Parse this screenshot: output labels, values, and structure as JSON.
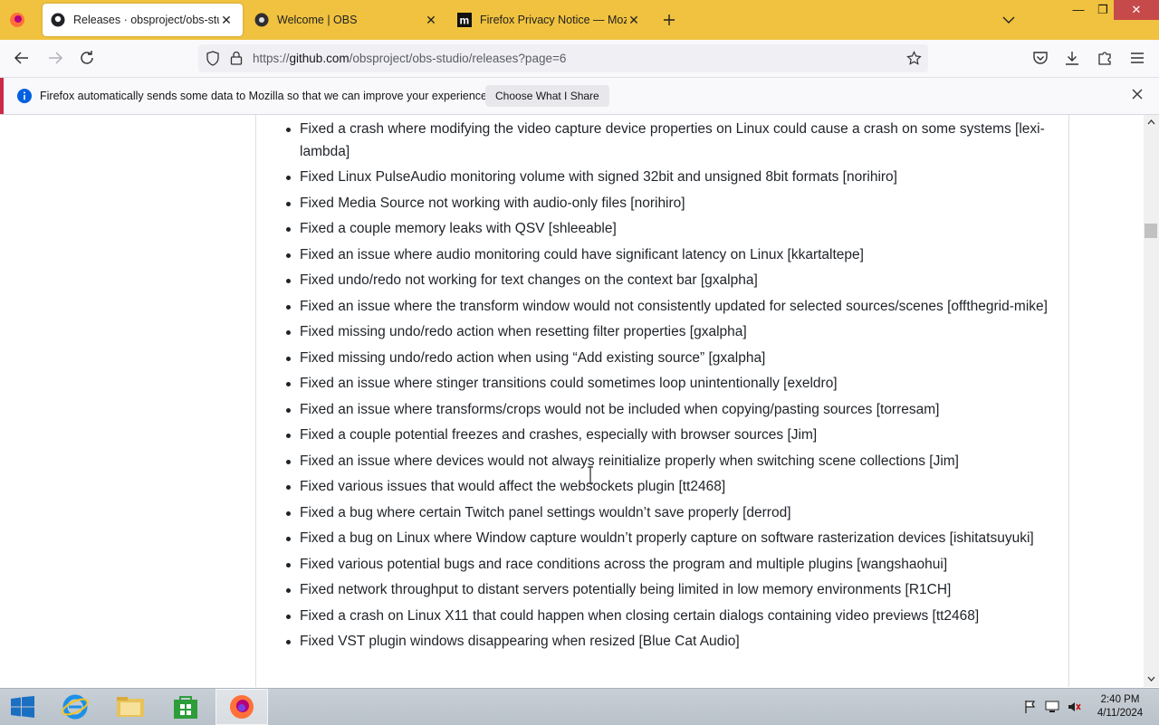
{
  "tabs": [
    {
      "title": "Releases · obsproject/obs-studi",
      "icon": "github-icon",
      "active": true
    },
    {
      "title": "Welcome | OBS",
      "icon": "obs-icon",
      "active": false
    },
    {
      "title": "Firefox Privacy Notice — Mozill",
      "icon": "mozilla-icon",
      "active": false
    }
  ],
  "address": {
    "prefix": "https://",
    "host": "github.com",
    "path": "/obsproject/obs-studio/releases?page=6"
  },
  "notification": {
    "message": "Firefox automatically sends some data to Mozilla so that we can improve your experience.",
    "button": "Choose What I Share"
  },
  "release_notes": [
    "Fixed a crash where modifying the video capture device properties on Linux could cause a crash on some systems [lexi-lambda]",
    "Fixed Linux PulseAudio monitoring volume with signed 32bit and unsigned 8bit formats [norihiro]",
    "Fixed Media Source not working with audio-only files [norihiro]",
    "Fixed a couple memory leaks with QSV [shleeable]",
    "Fixed an issue where audio monitoring could have significant latency on Linux [kkartaltepe]",
    "Fixed undo/redo not working for text changes on the context bar [gxalpha]",
    "Fixed an issue where the transform window would not consistently updated for selected sources/scenes [offthegrid-mike]",
    "Fixed missing undo/redo action when resetting filter properties [gxalpha]",
    "Fixed missing undo/redo action when using “Add existing source” [gxalpha]",
    "Fixed an issue where stinger transitions could sometimes loop unintentionally [exeldro]",
    "Fixed an issue where transforms/crops would not be included when copying/pasting sources [torresam]",
    "Fixed a couple potential freezes and crashes, especially with browser sources [Jim]",
    "Fixed an issue where devices would not always reinitialize properly when switching scene collections [Jim]",
    "Fixed various issues that would affect the websockets plugin [tt2468]",
    "Fixed a bug where certain Twitch panel settings wouldn’t save properly [derrod]",
    "Fixed a bug on Linux where Window capture wouldn’t properly capture on software rasterization devices [ishitatsuyuki]",
    "Fixed various potential bugs and race conditions across the program and multiple plugins [wangshaohui]",
    "Fixed network throughput to distant servers potentially being limited in low memory environments [R1CH]",
    "Fixed a crash on Linux X11 that could happen when closing certain dialogs containing video previews [tt2468]",
    "Fixed VST plugin windows disappearing when resized [Blue Cat Audio]"
  ],
  "taskbar": {
    "time": "2:40 PM",
    "date": "4/11/2024"
  },
  "colors": {
    "tabbar": "#f0c23f",
    "notification_accent": "#cc2a4a",
    "text": "#1f2328"
  }
}
